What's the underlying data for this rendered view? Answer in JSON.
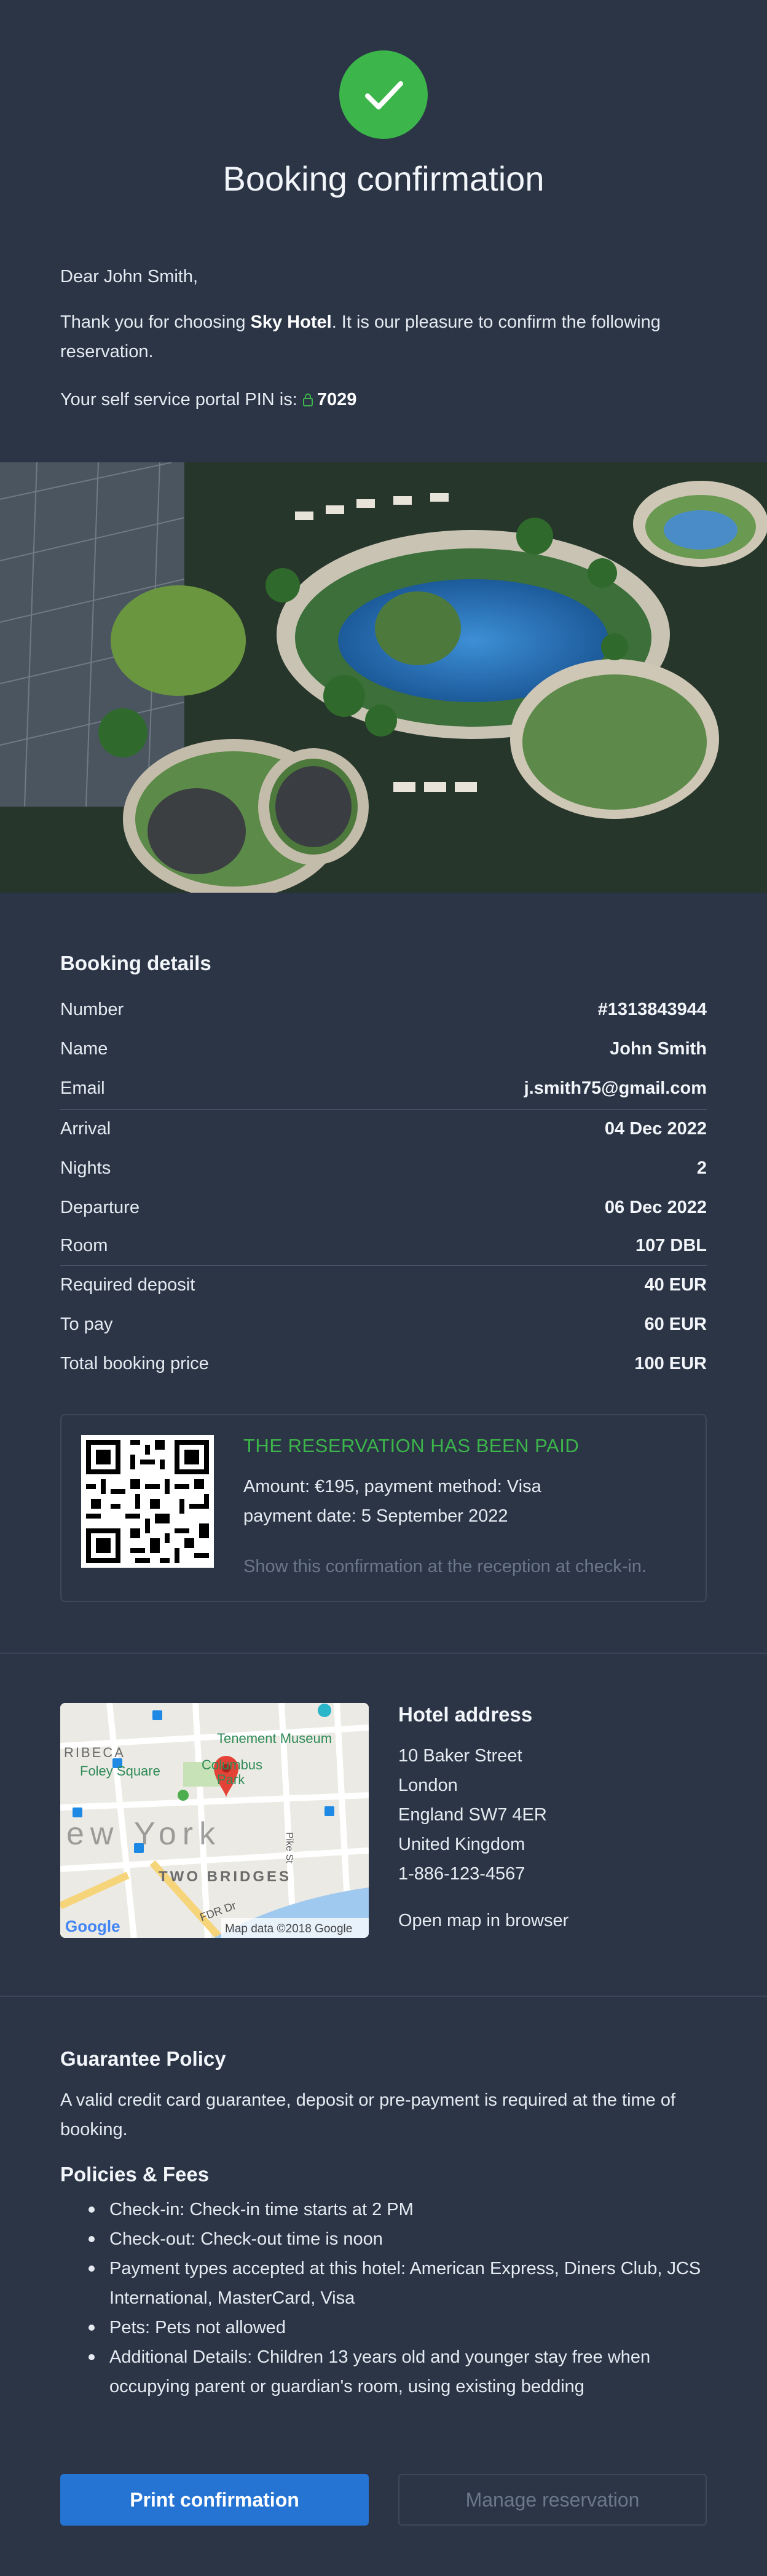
{
  "header": {
    "title": "Booking confirmation"
  },
  "intro": {
    "greeting": "Dear John Smith,",
    "thanks_pre": "Thank you for choosing ",
    "hotel_name": "Sky Hotel",
    "thanks_post": ". It is our pleasure to confirm the following reservation.",
    "pin_label": "Your self service portal PIN is: ",
    "pin": "7029"
  },
  "booking": {
    "title": "Booking details",
    "rows": [
      {
        "label": "Number",
        "value": "#1313843944"
      },
      {
        "label": "Name",
        "value": "John Smith"
      },
      {
        "label": "Email",
        "value": "j.smith75@gmail.com"
      },
      {
        "label": "Arrival",
        "value": "04 Dec 2022"
      },
      {
        "label": "Nights",
        "value": "2"
      },
      {
        "label": "Departure",
        "value": "06 Dec 2022"
      },
      {
        "label": "Room",
        "value": "107 DBL"
      },
      {
        "label": "Required deposit",
        "value": "40 EUR"
      },
      {
        "label": "To pay",
        "value": "60 EUR"
      },
      {
        "label": "Total booking price",
        "value": "100 EUR"
      }
    ]
  },
  "payment": {
    "status": "THE RESERVATION HAS BEEN PAID",
    "amount_line": "Amount: €195, payment method: Visa",
    "date_line": "payment date: 5 September 2022",
    "note": "Show this confirmation at the reception at check-in."
  },
  "address": {
    "title": "Hotel address",
    "lines": [
      "10 Baker Street",
      "London",
      "England SW7 4ER",
      "United Kingdom",
      "1-886-123-4567"
    ],
    "map_link": "Open map in browser",
    "map": {
      "labels": [
        "RIBECA",
        "Tenement Museum",
        "Foley Square",
        "Columbus",
        "Park",
        "ew York",
        "TWO BRIDGES",
        "Pike St",
        "FDR Dr"
      ],
      "logo": "Google",
      "attribution": "Map data ©2018 Google"
    }
  },
  "guarantee": {
    "title": "Guarantee Policy",
    "text": "A valid credit card guarantee, deposit or pre-payment is required at the time of booking."
  },
  "policies": {
    "title": "Policies & Fees",
    "items": [
      "Check-in: Check-in time starts at 2 PM",
      "Check-out: Check-out time is noon",
      "Payment types accepted at this hotel: American Express, Diners Club, JCS International, MasterCard, Visa",
      "Pets: Pets not allowed",
      "Additional Details: Children 13 years old and younger stay free when occupying parent or guardian's room, using existing bedding"
    ]
  },
  "actions": {
    "print": "Print confirmation",
    "manage": "Manage reservation"
  },
  "colors": {
    "background": "#2b3546",
    "success": "#3cb54a",
    "primary": "#2574d4",
    "muted": "#6b778a"
  }
}
